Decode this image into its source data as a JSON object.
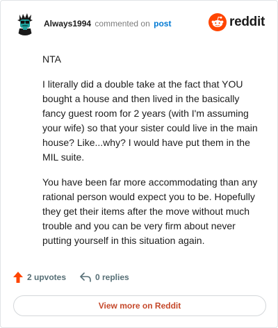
{
  "header": {
    "username": "Always1994",
    "action_text": "commented on",
    "post_link_label": "post",
    "brand_name": "reddit"
  },
  "comment": {
    "paragraphs": [
      "NTA",
      "I literally did a double take at the fact that YOU bought a house and then lived in the basically fancy guest room for 2 years (with I'm assuming your wife) so that your sister could live in the main house? Like...why? I would have put them in the MIL suite.",
      "You have been far more accommodating than any rational person would expect you to be. Hopefully they get their items after the move without much trouble and you can be very firm about never putting yourself in this situation again."
    ]
  },
  "footer": {
    "upvotes_label": "2 upvotes",
    "replies_label": "0 replies",
    "upvote_icon": "upvote-arrow-icon",
    "reply_icon": "reply-arrow-icon"
  },
  "cta": {
    "view_more_label": "View more on Reddit"
  },
  "colors": {
    "brand_orange": "#ff4500",
    "link_blue": "#0079d3",
    "cta_text": "#c5482a",
    "muted_text": "#576f76"
  }
}
